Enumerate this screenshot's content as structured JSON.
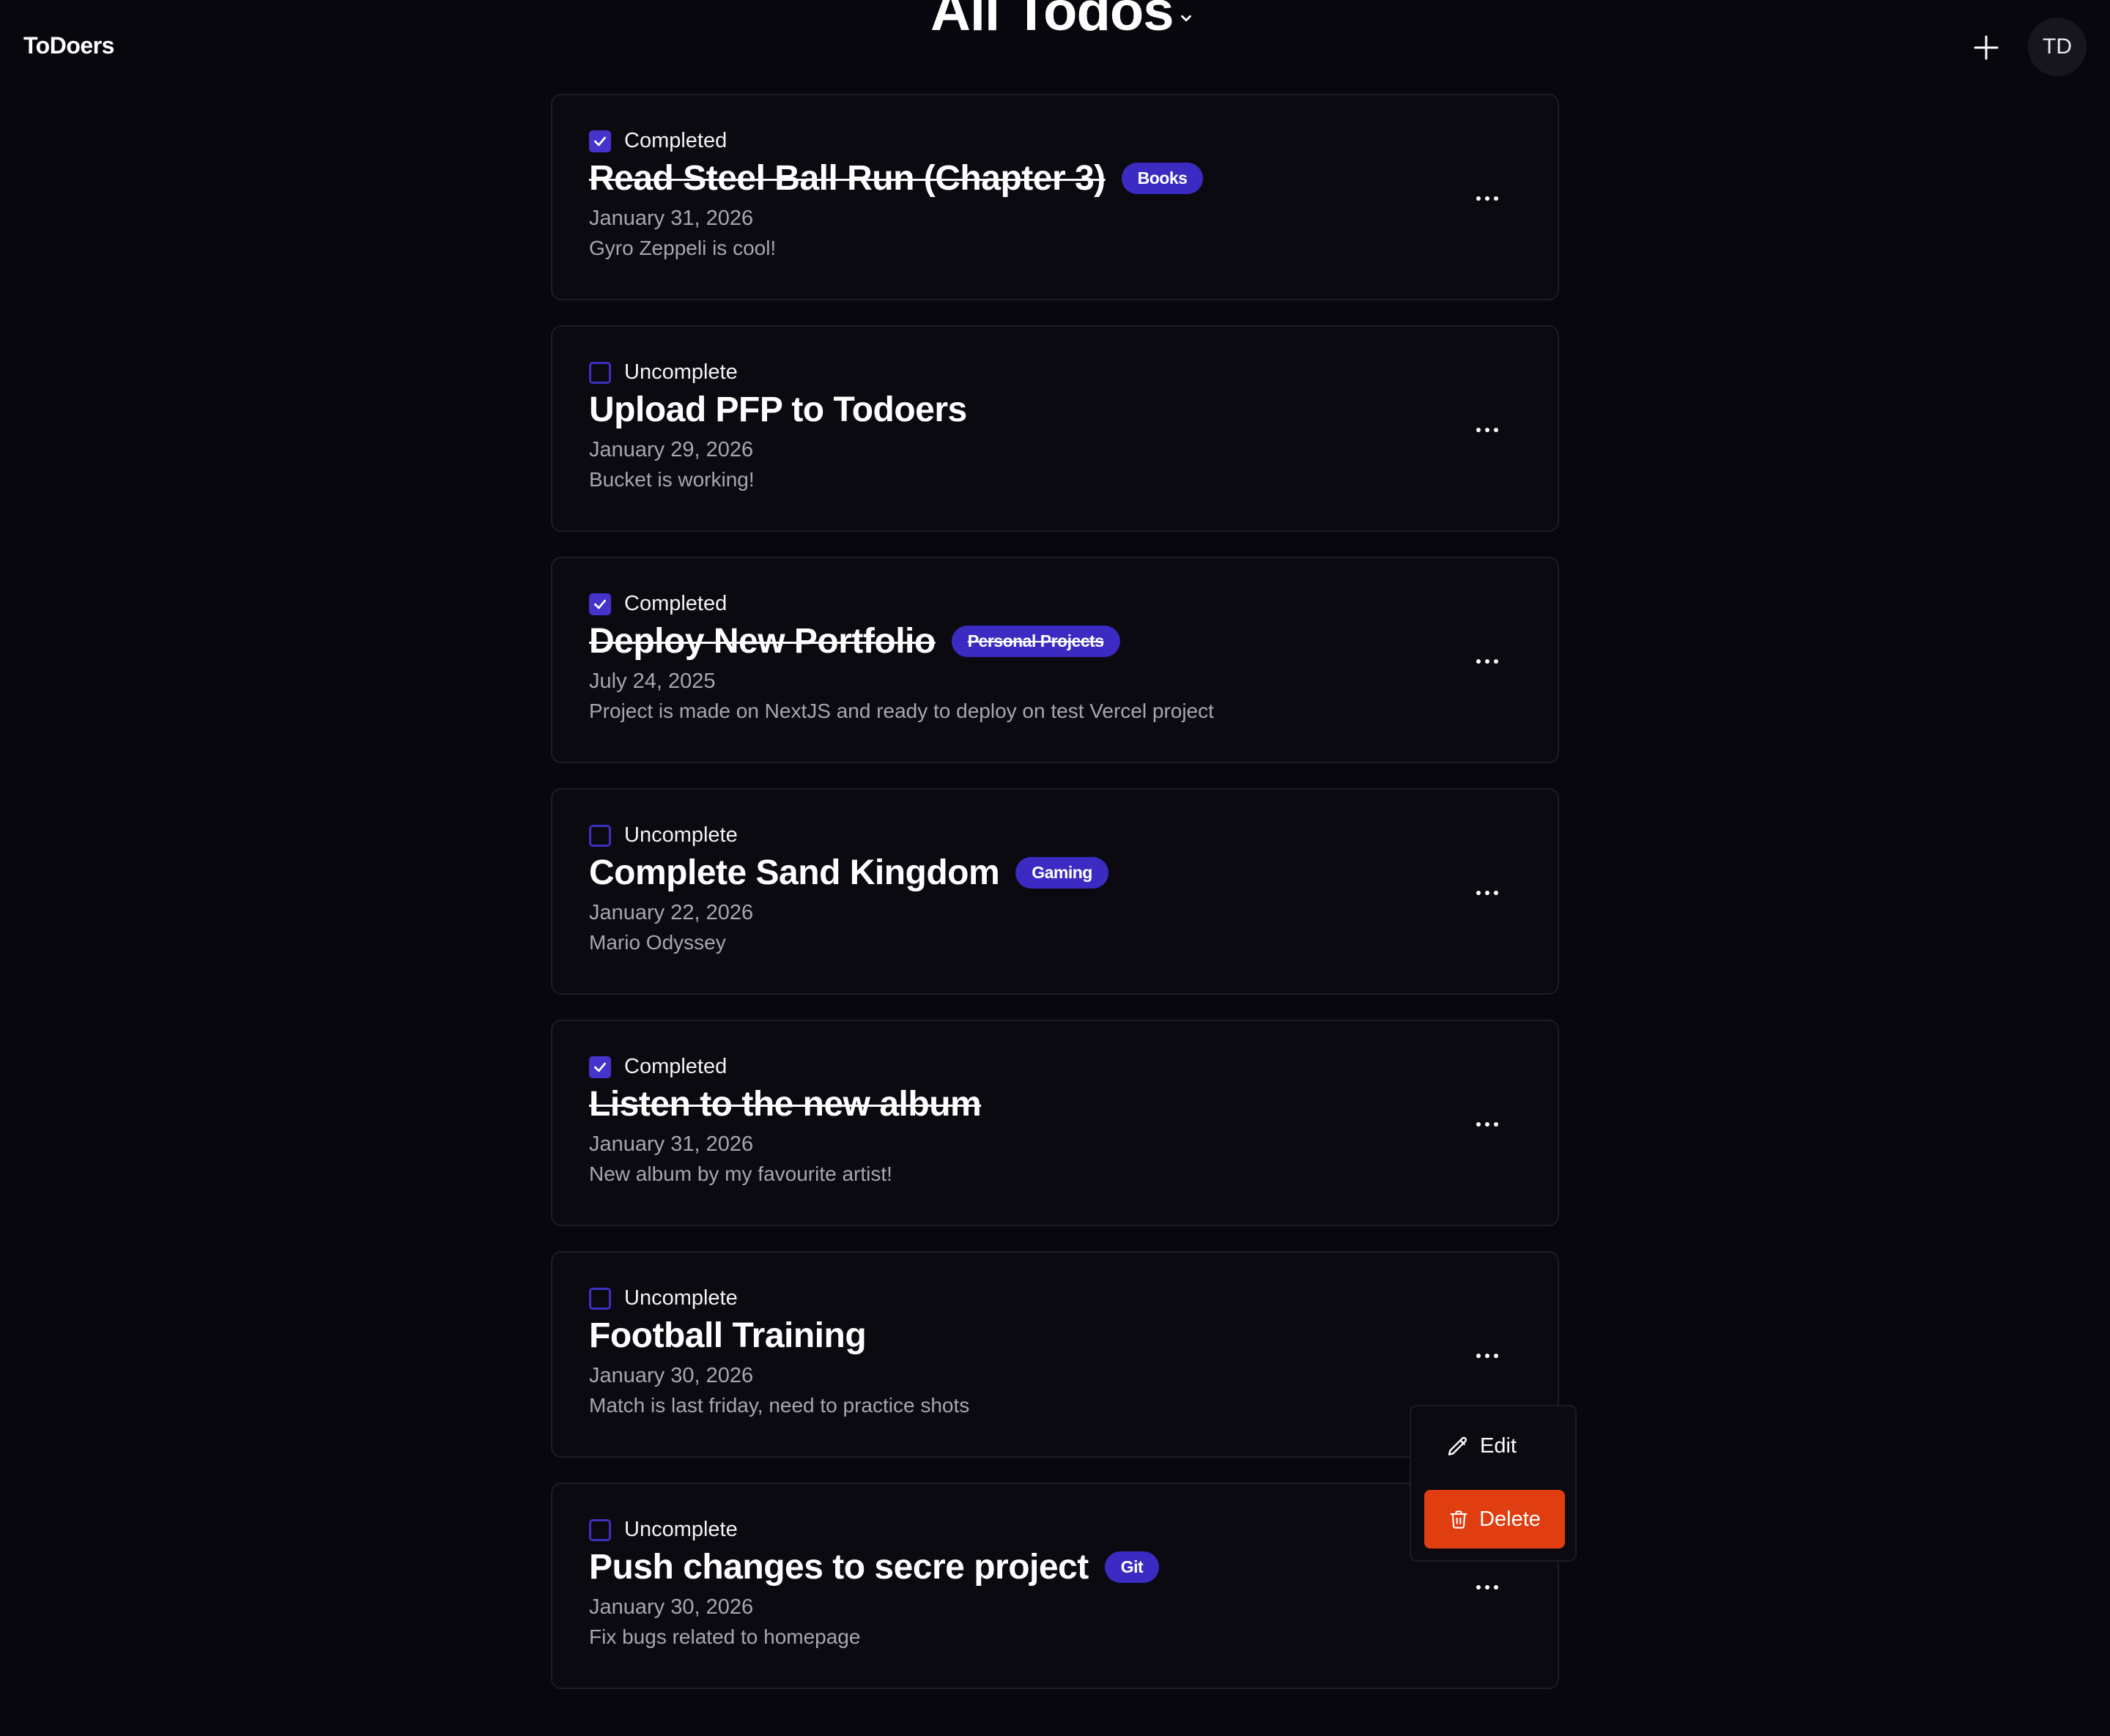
{
  "app": {
    "brand": "ToDoers",
    "user_initials": "TD"
  },
  "header": {
    "title": "All Todos",
    "add_icon": "plus-icon",
    "title_icon": "chevron-down-icon"
  },
  "colors": {
    "accent": "#3c2bc3",
    "danger": "#e03d10",
    "background": "#08070d"
  },
  "todos": [
    {
      "status": "Completed",
      "completed": true,
      "title": "Read Steel Ball Run (Chapter 3)",
      "tag": "Books",
      "date": "January 31, 2026",
      "description": "Gyro Zeppeli is cool!"
    },
    {
      "status": "Uncomplete",
      "completed": false,
      "title": "Upload PFP to Todoers",
      "tag": "",
      "date": "January 29, 2026",
      "description": "Bucket is working!"
    },
    {
      "status": "Completed",
      "completed": true,
      "title": "Deploy New Portfolio",
      "tag": "Personal Projects",
      "date": "July 24, 2025",
      "description": "Project is made on NextJS and ready to deploy on test Vercel project"
    },
    {
      "status": "Uncomplete",
      "completed": false,
      "title": "Complete Sand Kingdom",
      "tag": "Gaming",
      "date": "January 22, 2026",
      "description": "Mario Odyssey"
    },
    {
      "status": "Completed",
      "completed": true,
      "title": "Listen to the new album",
      "tag": "",
      "date": "January 31, 2026",
      "description": "New album by my favourite artist!"
    },
    {
      "status": "Uncomplete",
      "completed": false,
      "title": "Football Training",
      "tag": "",
      "date": "January 30, 2026",
      "description": "Match is last friday, need to practice shots"
    },
    {
      "status": "Uncomplete",
      "completed": false,
      "title": "Push changes to secre project",
      "tag": "Git",
      "date": "January 30, 2026",
      "description": "Fix bugs related to homepage"
    }
  ],
  "context_menu": {
    "edit_label": "Edit",
    "delete_label": "Delete",
    "edit_icon": "pencil-icon",
    "delete_icon": "trash-icon"
  }
}
